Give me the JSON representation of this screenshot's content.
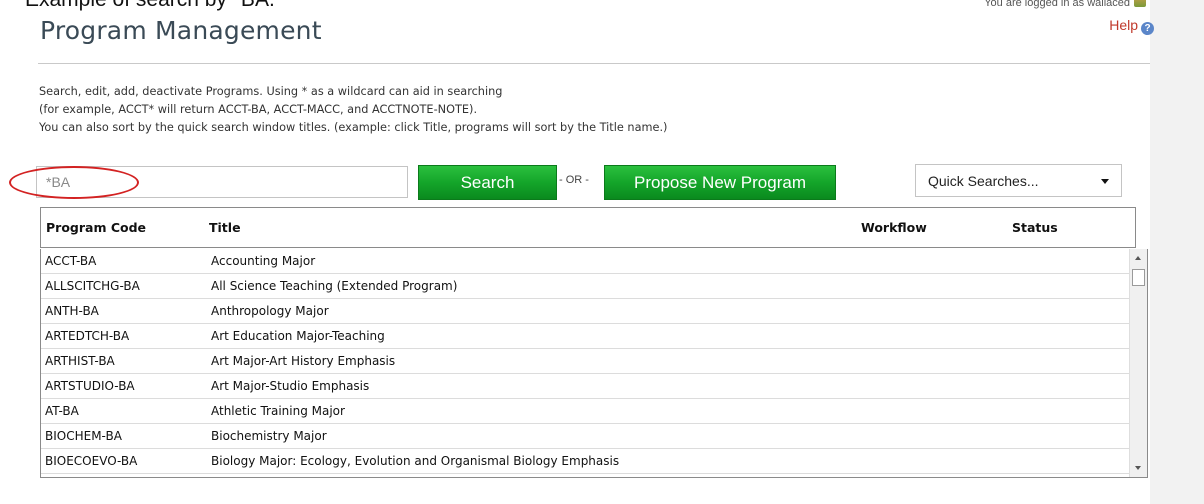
{
  "caption": "Example of search by *BA.",
  "header": {
    "title": "Program Management",
    "login_text": "You are logged in as wallaced",
    "help_label": "Help"
  },
  "description": {
    "line1": "Search, edit, add, deactivate Programs. Using * as a wildcard can aid in searching",
    "line2": "(for example, ACCT* will return ACCT-BA, ACCT-MACC, and ACCTNOTE-NOTE).",
    "line3": "You can also sort by the quick search window titles. (example: click Title, programs will sort by the Title name.)"
  },
  "search": {
    "value": "",
    "placeholder": "*BA",
    "button_label": "Search",
    "or_label": "- OR -",
    "propose_label": "Propose New Program",
    "quick_searches_label": "Quick Searches..."
  },
  "table": {
    "columns": {
      "code": "Program Code",
      "title": "Title",
      "workflow": "Workflow",
      "status": "Status"
    },
    "rows": [
      {
        "code": "ACCT-BA",
        "title": "Accounting Major"
      },
      {
        "code": "ALLSCITCHG-BA",
        "title": "All Science Teaching (Extended Program)"
      },
      {
        "code": "ANTH-BA",
        "title": "Anthropology Major"
      },
      {
        "code": "ARTEDTCH-BA",
        "title": "Art Education Major-Teaching"
      },
      {
        "code": "ARTHIST-BA",
        "title": "Art Major-Art History Emphasis"
      },
      {
        "code": "ARTSTUDIO-BA",
        "title": "Art Major-Studio Emphasis"
      },
      {
        "code": "AT-BA",
        "title": "Athletic Training Major"
      },
      {
        "code": "BIOCHEM-BA",
        "title": "Biochemistry Major"
      },
      {
        "code": "BIOECOEVO-BA",
        "title": "Biology Major: Ecology, Evolution and Organismal Biology Emphasis"
      }
    ]
  },
  "colors": {
    "button_green": "#14a52a",
    "help_red": "#c0392b",
    "annotation_red": "#d32222"
  },
  "icons": {
    "login": "user-icon",
    "help": "help-circle-icon"
  }
}
